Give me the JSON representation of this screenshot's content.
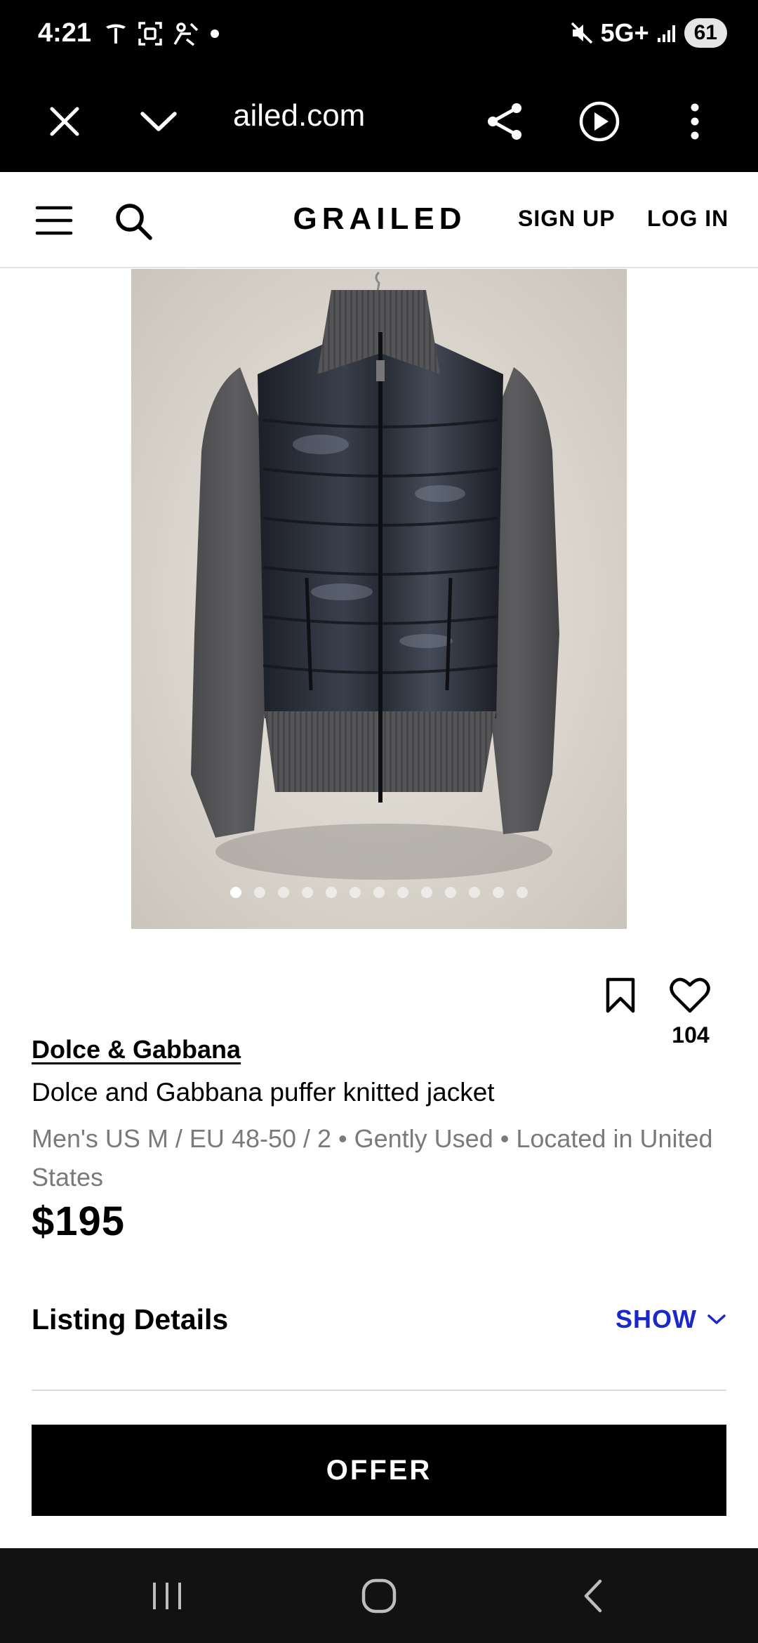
{
  "status_bar": {
    "time": "4:21",
    "network": "5G+",
    "battery": "61",
    "icons": [
      "tesla-icon",
      "screenshot-icon",
      "accessibility-icon",
      "dot-icon",
      "mute-icon",
      "signal-icon"
    ]
  },
  "browser": {
    "url": "ailed.com",
    "icons": [
      "close-icon",
      "chevron-down-icon",
      "share-icon",
      "play-icon",
      "more-vert-icon"
    ]
  },
  "header": {
    "logo": "GRAILED",
    "sign_up": "SIGN UP",
    "log_in": "LOG IN",
    "icons": [
      "menu-icon",
      "search-icon"
    ]
  },
  "gallery": {
    "image_count": 13,
    "active_index": 0
  },
  "actions": {
    "like_count": "104",
    "icons": [
      "bookmark-icon",
      "heart-icon"
    ]
  },
  "product": {
    "brand": "Dolce & Gabbana",
    "title": "Dolce and Gabbana puffer knitted jacket",
    "meta": "Men's US M / EU 48-50 / 2 • Gently Used • Located in United States",
    "price": "$195"
  },
  "listing_details": {
    "title": "Listing Details",
    "toggle_label": "SHOW"
  },
  "cta": {
    "offer_label": "OFFER"
  },
  "colors": {
    "accent_blue": "#1a28c8",
    "black": "#000000",
    "nav_bg": "#121212"
  },
  "nav": {
    "icons": [
      "recent-apps-icon",
      "home-icon",
      "back-icon"
    ]
  }
}
